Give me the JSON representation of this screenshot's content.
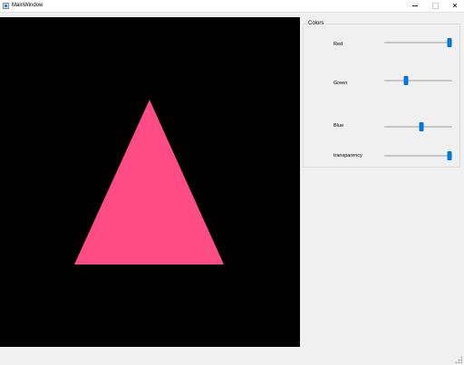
{
  "window": {
    "title": "MainWindow",
    "minimize_icon": "minimize-icon",
    "maximize_icon": "maximize-icon",
    "close_icon": "close-icon",
    "close_glyph": "✕"
  },
  "canvas": {
    "background": "#000000",
    "shape": "triangle",
    "fill_color": "#ff4b86"
  },
  "colors_group": {
    "title": "Colors",
    "sliders": [
      {
        "label": "Red",
        "value": 1.0
      },
      {
        "label": "Green",
        "value": 0.3
      },
      {
        "label": "Blue",
        "value": 0.55
      },
      {
        "label": "transparency",
        "value": 1.0
      }
    ]
  }
}
